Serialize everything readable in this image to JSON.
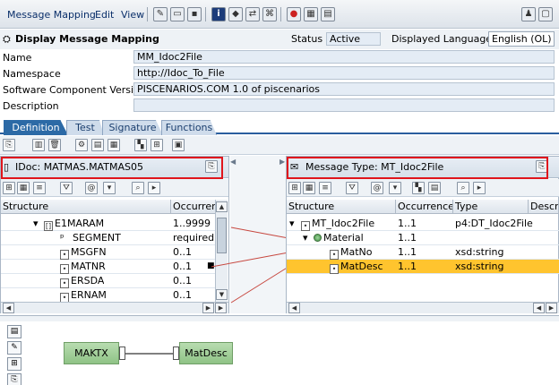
{
  "menubar": {
    "items": [
      "Message Mapping",
      "Edit",
      "View"
    ],
    "toolbar_icons": [
      "edit-pencil-icon",
      "display-icon",
      "save-icon",
      "info-icon",
      "eraser-icon",
      "navigate-icon",
      "where-used-icon",
      "record-icon",
      "table-icon",
      "log-icon",
      "user-icon",
      "window-icon"
    ]
  },
  "header": {
    "title": "Display Message Mapping",
    "status_label": "Status",
    "status_value": "Active",
    "display_language_label": "Displayed Language",
    "display_language_value": "English (OL)"
  },
  "fields": [
    {
      "label": "Name",
      "value": "MM_Idoc2File"
    },
    {
      "label": "Namespace",
      "value": "http://Idoc_To_File"
    },
    {
      "label": "Software Component Version",
      "value": "PISCENARIOS.COM 1.0 of piscenarios"
    },
    {
      "label": "Description",
      "value": ""
    }
  ],
  "tabs": [
    "Definition",
    "Test",
    "Signature",
    "Functions"
  ],
  "active_tab": "Definition",
  "source": {
    "title": "IDoc: MATMAS.MATMAS05",
    "columns": [
      "Structure",
      "Occurrences"
    ],
    "rows": [
      {
        "name": "E1MARAM",
        "occurrence": "1..9999",
        "selected": false
      },
      {
        "name": "SEGMENT",
        "occurrence": "required",
        "selected": false
      },
      {
        "name": "MSGFN",
        "occurrence": "0..1",
        "selected": false
      },
      {
        "name": "MATNR",
        "occurrence": "0..1",
        "selected": false
      },
      {
        "name": "ERSDA",
        "occurrence": "0..1",
        "selected": false
      },
      {
        "name": "ERNAM",
        "occurrence": "0..1",
        "selected": false
      }
    ]
  },
  "target": {
    "title": "Message Type: MT_Idoc2File",
    "columns": [
      "Structure",
      "Occurrences",
      "Type",
      "Description"
    ],
    "rows": [
      {
        "name": "MT_Idoc2File",
        "occurrence": "1..1",
        "type": "p4:DT_Idoc2File",
        "selected": false
      },
      {
        "name": "Material",
        "occurrence": "1..1",
        "type": "",
        "selected": false
      },
      {
        "name": "MatNo",
        "occurrence": "1..1",
        "type": "xsd:string",
        "selected": false
      },
      {
        "name": "MatDesc",
        "occurrence": "1..1",
        "type": "xsd:string",
        "selected": true
      }
    ]
  },
  "editor": {
    "source_box": "MAKTX",
    "target_box": "MatDesc"
  },
  "colors": {
    "selection": "#ffc42e",
    "highlight_border": "#e0151c",
    "active_tab": "#2c6aa6",
    "function_box": "#8fc386"
  }
}
